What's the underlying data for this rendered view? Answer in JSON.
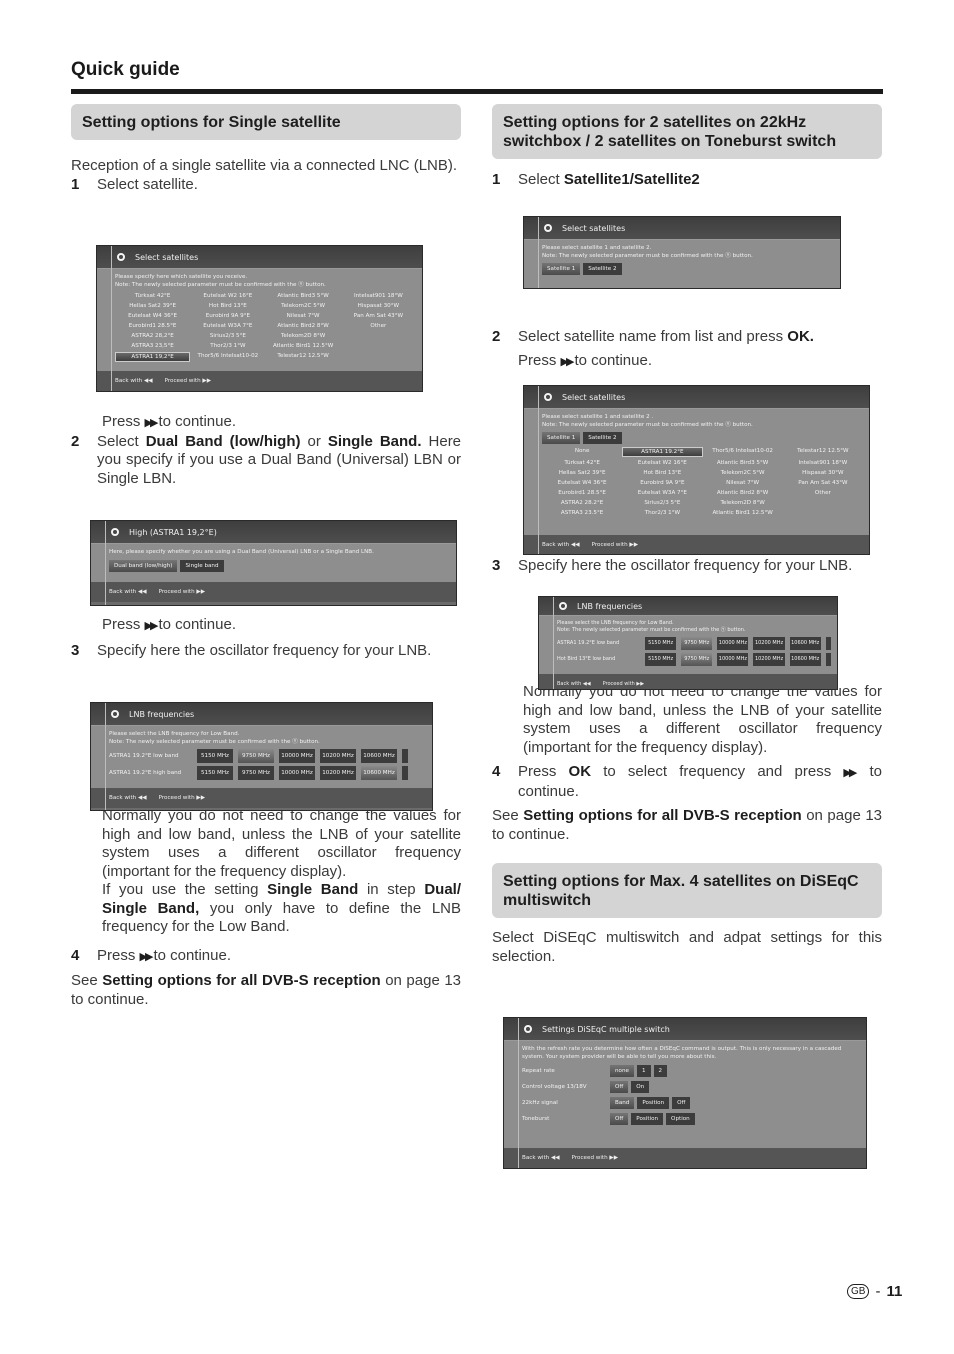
{
  "page": {
    "title": "Quick guide",
    "region_badge": "GB",
    "page_sep": "-",
    "page_number": "11"
  },
  "left": {
    "heading": "Setting options for Single satellite",
    "intro": "Reception of a single satellite via a connected LNC (LNB).",
    "step1": {
      "num": "1",
      "text": "Select satellite."
    },
    "press_continue_1": "to continue.",
    "press_word": "Press",
    "step2": {
      "num": "2",
      "pre": "Select",
      "bold1": "Dual Band (low/high)",
      "mid": "or",
      "bold2": "Single Band.",
      "rest": "Here you specify if you use a Dual Band (Universal) LBN or Single LBN."
    },
    "step3": {
      "num": "3",
      "text": "Specify here the oscillator frequency for your LNB."
    },
    "note": "Normally you do not need to change the values for high and low band, unless the LNB of your satellite system uses a different oscillator frequency (important for the frequency display).",
    "note2": {
      "pre": "If you use the setting",
      "b1": "Single Band",
      "mid": "in step",
      "b2": "Dual/ Single Band,",
      "post": "you only have to define the LNB frequency for the Low Band."
    },
    "step4": {
      "num": "4",
      "pre": "Press",
      "post": "to continue."
    },
    "see": {
      "pre": "See",
      "bold": "Setting options for all DVB-S reception",
      "post": "on page 13 to continue."
    }
  },
  "right": {
    "heading": "Setting options for 2 satellites on 22kHz switchbox / 2 satellites on Toneburst switch",
    "step1": {
      "num": "1",
      "pre": "Select",
      "bold": "Satellite1/Satellite2"
    },
    "step2": {
      "num": "2",
      "pre": "Select satellite name from list and press",
      "bold": "OK.",
      "press": "Press",
      "post": "to continue."
    },
    "step3": {
      "num": "3",
      "text": "Specify here the oscillator frequency for your LNB."
    },
    "note": "Normally you do not need to change the values for high and low band, unless the LNB of your satellite system uses a different oscillator frequency (important for the frequency display).",
    "step4": {
      "num": "4",
      "pre": "Press",
      "bold": "OK",
      "mid": "to select frequency and press",
      "post": "to continue."
    },
    "see": {
      "pre": "See",
      "bold": "Setting options for all DVB-S reception",
      "post": "on page 13 to continue."
    },
    "heading2": "Setting options for Max. 4 satellites on DiSEqC multiswitch",
    "diseqc_intro": "Select DiSEqC multiswitch and adpat settings for this selection."
  },
  "tv_common": {
    "back": "Back with ◀◀",
    "proceed": "Proceed with ▶▶",
    "note": "Note: The newly selected parameter must be confirmed with the Ⓨ button."
  },
  "screen_single": {
    "title": "Select satellites",
    "prompt": "Please specify here which satellite you receive.",
    "grid": [
      "Türksat 42°E",
      "Eutelsat W2 16°E",
      "Atlantic Bird3 5°W",
      "Intelsat901 18°W",
      "Hellas Sat2 39°E",
      "Hot Bird 13°E",
      "Telekom2C 5°W",
      "Hispasat 30°W",
      "Eutelsat W4 36°E",
      "Eurobird 9A 9°E",
      "Nilesat 7°W",
      "Pan Am Sat 43°W",
      "Eurobird1 28.5°E",
      "Eutelsat W3A 7°E",
      "Atlantic Bird2 8°W",
      "Other",
      "ASTRA2 28,2°E",
      "Sirius2/3 5°E",
      "Telekom2D 8°W",
      "",
      "ASTRA3 23,5°E",
      "Thor2/3 1°W",
      "Atlantic Bird1 12.5°W",
      "",
      "ASTRA1 19,2°E",
      "Thor5/6 Intelsat10-02",
      "Telestar12 12.5°W",
      ""
    ],
    "selected": "ASTRA1 19,2°E"
  },
  "screen_band": {
    "title": "High (ASTRA1 19,2°E)",
    "prompt": "Here, please specify whether you are using a Dual Band (Universal) LNB or a Single Band LNB.",
    "options": [
      "Dual band (low/high)",
      "Single band"
    ],
    "selected": "Dual band (low/high)"
  },
  "screen_lnb_left": {
    "title": "LNB frequencies",
    "prompt": "Please select the LNB frequency for  Low Band.",
    "rows": [
      {
        "label": "ASTRA1 19.2°E low band",
        "values": [
          "5150 MHz",
          "9750 MHz",
          "10000 MHz",
          "10200 MHz",
          "10600 MHz"
        ],
        "selected": "9750 MHz"
      },
      {
        "label": "ASTRA1 19.2°E high band",
        "values": [
          "5150 MHz",
          "9750 MHz",
          "10000 MHz",
          "10200 MHz",
          "10600 MHz"
        ],
        "selected": "10600 MHz"
      }
    ]
  },
  "screen_two_tabs": {
    "title": "Select satellites",
    "prompt": "Please select satellite 1 and satellite 2.",
    "tabs": [
      "Satellite 1",
      "Satellite 2"
    ],
    "active_tab": "Satellite 1"
  },
  "screen_two_list": {
    "title": "Select satellites",
    "prompt": "Please select satellite 1 and satellite 2 .",
    "tabs": [
      "Satellite 1",
      "Satellite 2"
    ],
    "active_tab": "Satellite 1",
    "grid": [
      "None",
      "ASTRA1 19.2°E",
      "Thor5/6 Intelsat10-02",
      "Telestar12 12.5°W",
      "Türksat 42°E",
      "Eutelsat W2 16°E",
      "Atlantic Bird3 5°W",
      "Intelsat901 18°W",
      "Hellas Sat2 39°E",
      "Hot Bird 13°E",
      "Telekom2C 5°W",
      "Hispasat 30°W",
      "Eutelsat W4 36°E",
      "Eurobird 9A 9°E",
      "Nilesat 7°W",
      "Pan Am Sat 43°W",
      "Eurobird1 28.5°E",
      "Eutelsat W3A 7°E",
      "Atlantic Bird2 8°W",
      "Other",
      "ASTRA2 28.2°E",
      "Sirius2/3 5°E",
      "Telekom2D 8°W",
      "",
      "ASTRA3 23.5°E",
      "Thor2/3 1°W",
      "Atlantic Bird1 12.5°W",
      ""
    ],
    "selected": "ASTRA1 19.2°E"
  },
  "screen_lnb_right": {
    "title": "LNB frequencies",
    "prompt": "Please select the LNB frequency for  Low Band.",
    "rows": [
      {
        "label": "ASTRA1 19.2°E low band",
        "values": [
          "5150 MHz",
          "9750 MHz",
          "10000 MHz",
          "10200 MHz",
          "10600 MHz"
        ],
        "selected": "9750 MHz"
      },
      {
        "label": "Hot Bird 13°E low band",
        "values": [
          "5150 MHz",
          "9750 MHz",
          "10000 MHz",
          "10200 MHz",
          "10600 MHz"
        ],
        "selected": "9750 MHz"
      }
    ]
  },
  "screen_diseqc": {
    "title": "Settings DiSEqC multiple switch",
    "prompt": "With the refresh rate you determine how often a DiSEqC command is output. This is only necessary in a cascaded system. Your system provider will be able to tell you more about this.",
    "rows": [
      {
        "label": "Repeat rate",
        "options": [
          "none",
          "1",
          "2"
        ],
        "selected": "none"
      },
      {
        "label": "Control voltage 13/18V",
        "options": [
          "Off",
          "On"
        ],
        "selected": "Off"
      },
      {
        "label": "22kHz signal",
        "options": [
          "Band",
          "Position",
          "Off"
        ],
        "selected": "Band"
      },
      {
        "label": "Toneburst",
        "options": [
          "Off",
          "Position",
          "Option"
        ],
        "selected": "Off"
      }
    ]
  }
}
